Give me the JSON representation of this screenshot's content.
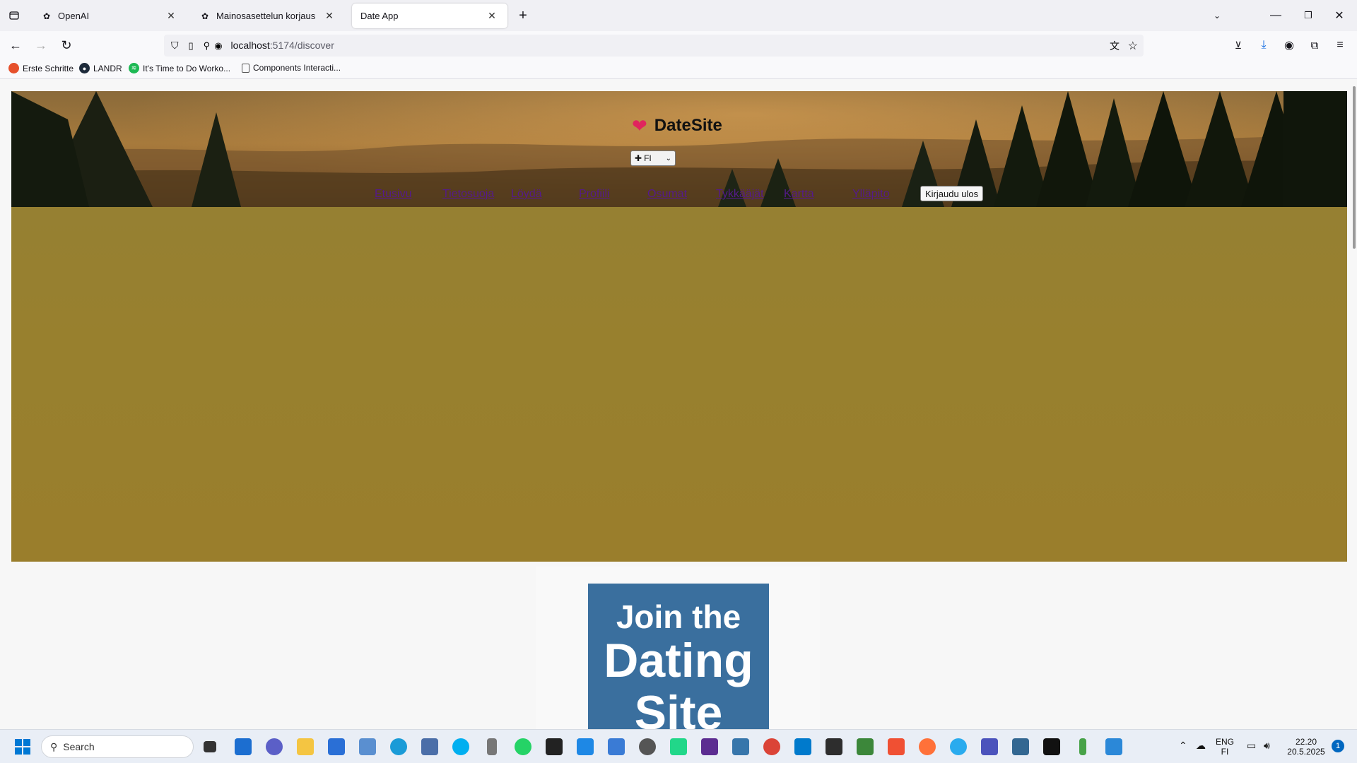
{
  "browser": {
    "tabs": [
      {
        "title": "OpenAI",
        "favicon": "openai-icon",
        "active": false
      },
      {
        "title": "Mainosasettelun korjaus",
        "favicon": "openai-icon",
        "active": false
      },
      {
        "title": "Date App",
        "favicon": "",
        "active": true
      }
    ],
    "url": {
      "host": "localhost",
      "path": ":5174/discover"
    },
    "bookmarks": [
      {
        "label": "Erste Schritte",
        "icon": "firefox-icon"
      },
      {
        "label": "LANDR",
        "icon": "landr-icon"
      },
      {
        "label": "It's Time to Do Worko...",
        "icon": "spotify-icon"
      },
      {
        "label": "Components Interacti...",
        "icon": "page-icon"
      }
    ]
  },
  "site": {
    "brand": "DateSite",
    "language": "FI",
    "nav": [
      "Etusivu",
      "Tietosuoja",
      "Löydä",
      "Profiili",
      "Osumat",
      "Tykkääjät",
      "Kartta",
      "Ylläpito"
    ],
    "logout_label": "Kirjaudu ulos"
  },
  "ad": {
    "line1": "Join the",
    "line2": "Dating",
    "line3": "Site",
    "background": "#3a6f9e"
  },
  "taskbar": {
    "search_placeholder": "Search",
    "lang_top": "ENG",
    "lang_bottom": "FI",
    "time": "22.20",
    "date": "20.5.2025",
    "notification_count": "1"
  },
  "colors": {
    "accent_heart": "#e0245e",
    "panel": "#98802e",
    "link_visited": "#551a8b"
  }
}
